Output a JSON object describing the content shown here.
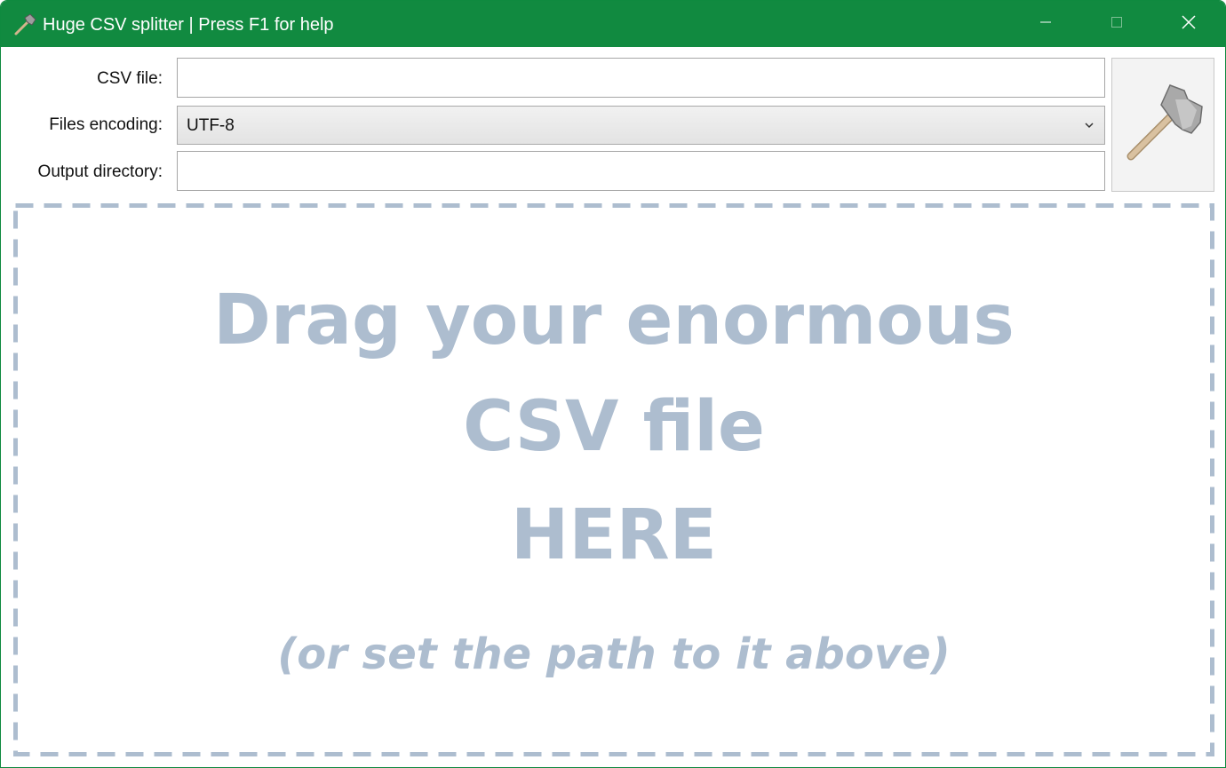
{
  "window": {
    "title": "Huge CSV splitter | Press F1 for help",
    "app_icon": "axe-icon",
    "controls": [
      "minimize-icon",
      "maximize-icon",
      "close-icon"
    ],
    "accent_color": "#118a40"
  },
  "form": {
    "csv_file": {
      "label": "CSV file:",
      "value": ""
    },
    "encoding": {
      "label": "Files encoding:",
      "value": "UTF-8"
    },
    "output_directory": {
      "label": "Output directory:",
      "value": ""
    },
    "split_button_icon": "axe-icon"
  },
  "dropzone": {
    "line1": "Drag your enormous",
    "line2": "CSV file",
    "line3": "HERE",
    "hint": "(or set the path to it above)",
    "text_color": "#adbdcf"
  }
}
